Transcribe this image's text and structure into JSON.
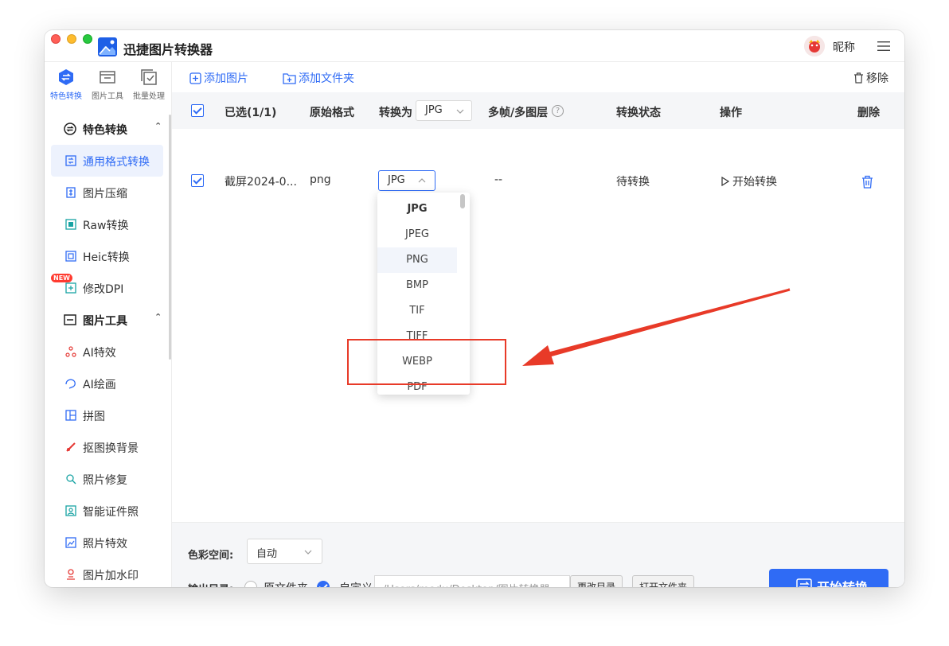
{
  "app": {
    "title": "迅捷图片转换器",
    "nickname": "昵称"
  },
  "colors": {
    "accent": "#2f6bf5",
    "annotation": "#e83a28"
  },
  "topnav": [
    {
      "label": "特色转换",
      "icon": "convert-icon"
    },
    {
      "label": "图片工具",
      "icon": "image-tools-icon"
    },
    {
      "label": "批量处理",
      "icon": "batch-icon"
    }
  ],
  "sidebar": {
    "section1": {
      "label": "特色转换"
    },
    "section1_items": [
      {
        "label": "通用格式转换"
      },
      {
        "label": "图片压缩"
      },
      {
        "label": "Raw转换"
      },
      {
        "label": "Heic转换"
      },
      {
        "label": "修改DPI",
        "badge": "NEW"
      }
    ],
    "section2": {
      "label": "图片工具"
    },
    "section2_items": [
      {
        "label": "AI特效"
      },
      {
        "label": "AI绘画"
      },
      {
        "label": "拼图"
      },
      {
        "label": "抠图换背景"
      },
      {
        "label": "照片修复"
      },
      {
        "label": "智能证件照"
      },
      {
        "label": "照片特效"
      },
      {
        "label": "图片加水印"
      }
    ]
  },
  "toolbar": {
    "add_image": "添加图片",
    "add_folder": "添加文件夹",
    "remove": "移除"
  },
  "table": {
    "headers": {
      "selected": "已选(1/1)",
      "original_format": "原始格式",
      "convert_to": "转换为",
      "convert_to_value": "JPG",
      "multi_frame": "多帧/多图层",
      "status": "转换状态",
      "action": "操作",
      "delete": "删除"
    },
    "rows": [
      {
        "name": "截屏2024-0...",
        "format": "png",
        "target": "JPG",
        "frames": "--",
        "status": "待转换",
        "action": "开始转换"
      }
    ]
  },
  "dropdown": {
    "options": [
      "JPG",
      "JPEG",
      "PNG",
      "BMP",
      "TIF",
      "TIFF",
      "WEBP",
      "PDF"
    ],
    "selected": "JPG",
    "hovered": "PNG"
  },
  "bottom": {
    "color_space_label": "色彩空间:",
    "color_space_value": "自动",
    "output_label": "输出目录:",
    "radio_original": "原文件夹",
    "radio_custom": "自定义",
    "path_placeholder": "/Users/modu/Desktop/图片转换器",
    "change_dir": "更改目录",
    "open_folder": "打开文件夹",
    "start_button": "开始转换"
  }
}
